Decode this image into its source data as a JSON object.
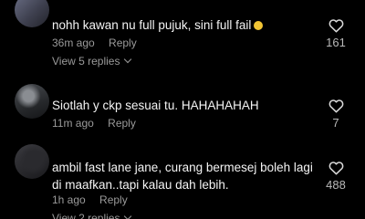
{
  "comments": [
    {
      "text": "nohh kawan nu full pujuk, sini full fail",
      "emoji": "grinning-sweat-emoji",
      "time": "36m ago",
      "reply_label": "Reply",
      "likes": "161",
      "view_replies": "View 5 replies"
    },
    {
      "text": "Siotlah y ckp sesuai tu. HAHAHAHAH",
      "time": "11m ago",
      "reply_label": "Reply",
      "likes": "7"
    },
    {
      "text": "ambil fast lane jane, curang bermesej boleh lagi di maafkan..tapi kalau dah lebih.",
      "time": "1h ago",
      "reply_label": "Reply",
      "likes": "488",
      "view_replies": "View 2 replies"
    }
  ],
  "colors": {
    "background": "#000000",
    "text": "#f4f4f4",
    "meta": "#9a9a9a",
    "emoji": "#f2c534"
  },
  "icons": {
    "like": "heart-outline-icon",
    "expand": "chevron-down-icon"
  }
}
